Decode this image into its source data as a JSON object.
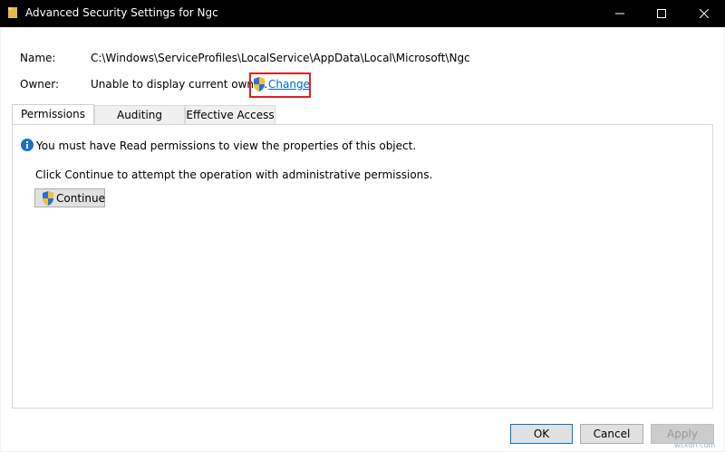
{
  "window": {
    "title": "Advanced Security Settings for Ngc",
    "controls": [
      "minimize-icon",
      "maximize-icon",
      "close-icon"
    ]
  },
  "details": {
    "name_label": "Name:",
    "name_value": "C:\\Windows\\ServiceProfiles\\LocalService\\AppData\\Local\\Microsoft\\Ngc",
    "owner_label": "Owner:",
    "owner_value": "Unable to display current owner.",
    "change_link": "Change"
  },
  "tabs": [
    {
      "label": "Permissions",
      "active": true
    },
    {
      "label": "Auditing",
      "active": false
    },
    {
      "label": "Effective Access",
      "active": false
    }
  ],
  "panel": {
    "info_message": "You must have Read permissions to view the properties of this object.",
    "continue_message": "Click Continue to attempt the operation with administrative permissions.",
    "continue_button": "Continue"
  },
  "footer": {
    "ok": "OK",
    "cancel": "Cancel",
    "apply": "Apply"
  },
  "watermark": "wsxdn.com",
  "colors": {
    "titlebar": "#000000",
    "link": "#0066cc",
    "highlight_box": "#e02020",
    "info_icon": "#1a6fc9"
  }
}
